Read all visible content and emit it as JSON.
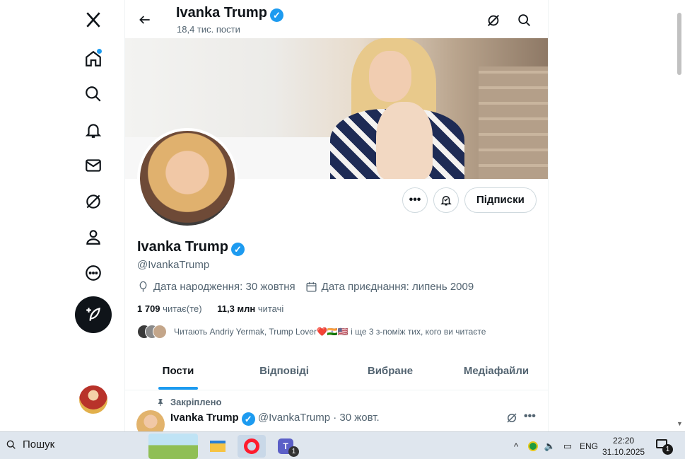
{
  "header": {
    "name": "Ivanka Trump",
    "posts_count": "18,4 тис. пости"
  },
  "profile": {
    "name": "Ivanka Trump",
    "handle": "@IvankaTrump",
    "birthday": "Дата народження: 30 жовтня",
    "joined": "Дата приєднання: липень 2009",
    "following_count": "1 709",
    "following_label": "читає(те)",
    "followers_count": "11,3 млн",
    "followers_label": "читачі",
    "followed_by": "Читають Andriy Yermak, Trump Lover❤️🇮🇳🇺🇸 і ще 3 з-поміж тих, кого ви читаєте",
    "subscriptions_button": "Підписки",
    "more_button": "•••",
    "verified_mark": "✓"
  },
  "tabs": [
    {
      "label": "Пости",
      "active": true
    },
    {
      "label": "Відповіді",
      "active": false
    },
    {
      "label": "Вибране",
      "active": false
    },
    {
      "label": "Медіафайли",
      "active": false
    }
  ],
  "pinned_post": {
    "pinned_label": "Закріплено",
    "author": "Ivanka Trump",
    "handle_date": "@IvankaTrump · 30 жовт.",
    "more": "•••"
  },
  "taskbar": {
    "search_label": "Пошук",
    "teams_badge": "1",
    "language": "ENG",
    "time": "22:20",
    "date": "31.10.2025",
    "notification_count": "1"
  },
  "colors": {
    "accent": "#1d9bf0",
    "text": "#0f1419",
    "muted": "#536471"
  }
}
